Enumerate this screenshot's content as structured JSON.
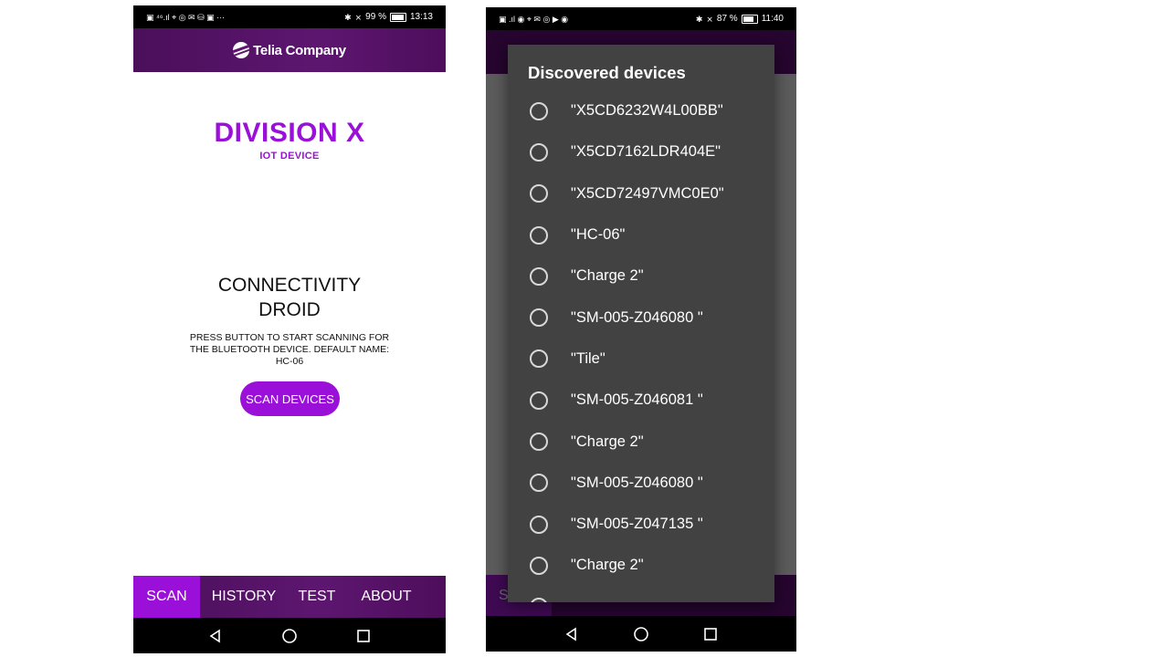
{
  "screen1": {
    "status": {
      "left_icons": "▣ ⁴⁶.ıl ⌖ ◎ ✉ ⛁ ▣ ···",
      "battery": "99 %",
      "battery_level": 0.99,
      "time": "13:13"
    },
    "brand": "Telia Company",
    "division_title": "DIVISION X",
    "division_subtitle": "IOT DEVICE",
    "app_title_line1": "CONNECTIVITY",
    "app_title_line2": "DROID",
    "instructions": "PRESS BUTTON TO START SCANNING FOR THE BLUETOOTH DEVICE. DEFAULT NAME: HC-06",
    "scan_button": "SCAN DEVICES",
    "tabs": [
      {
        "label": "SCAN"
      },
      {
        "label": "HISTORY"
      },
      {
        "label": "TEST"
      },
      {
        "label": "ABOUT"
      }
    ]
  },
  "screen2": {
    "status": {
      "left_icons": "▣ .ıl ◉ ⌖ ✉ ◎ ▶ ◉",
      "battery": "87 %",
      "battery_level": 0.87,
      "time": "11:40"
    },
    "dialog_title": "Discovered devices",
    "devices": [
      "\"X5CD6232W4L00BB\"",
      "\"X5CD7162LDR404E\"",
      "\"X5CD72497VMC0E0\"",
      "\"HC-06\"",
      "\"Charge 2\"",
      "\"SM-005-Z046080 \"",
      "\"Tile\"",
      "\"SM-005-Z046081 \"",
      "\"Charge 2\"",
      "\"SM-005-Z046080 \"",
      "\"SM-005-Z047135 \"",
      "\"Charge 2\""
    ],
    "tab_partial": "S"
  },
  "colors": {
    "accent": "#9b10d8",
    "brand_bar": "#5d1670",
    "dialog": "#424242"
  }
}
